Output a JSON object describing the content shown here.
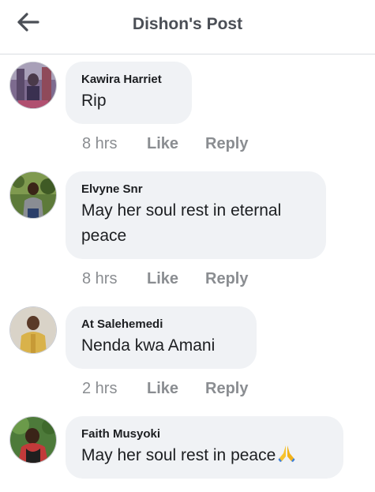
{
  "header": {
    "title": "Dishon's Post",
    "back_icon": "arrow-left-icon"
  },
  "comments": [
    {
      "author": "Kawira Harriet",
      "text": "Rip",
      "time": "8 hrs",
      "like": "Like",
      "reply": "Reply"
    },
    {
      "author": "Elvyne Snr",
      "text": "May her soul rest in eternal peace",
      "time": "8 hrs",
      "like": "Like",
      "reply": "Reply"
    },
    {
      "author": "At Salehemedi",
      "text": "Nenda kwa Amani",
      "time": "2 hrs",
      "like": "Like",
      "reply": "Reply"
    },
    {
      "author": "Faith Musyoki",
      "text": "May her soul rest in peace",
      "emoji": "folded-hands-emoji-icon",
      "time": "",
      "like": "",
      "reply": ""
    }
  ],
  "colors": {
    "bubble": "#f0f2f5",
    "meta": "#8a8d91",
    "title": "#4b4f56"
  }
}
